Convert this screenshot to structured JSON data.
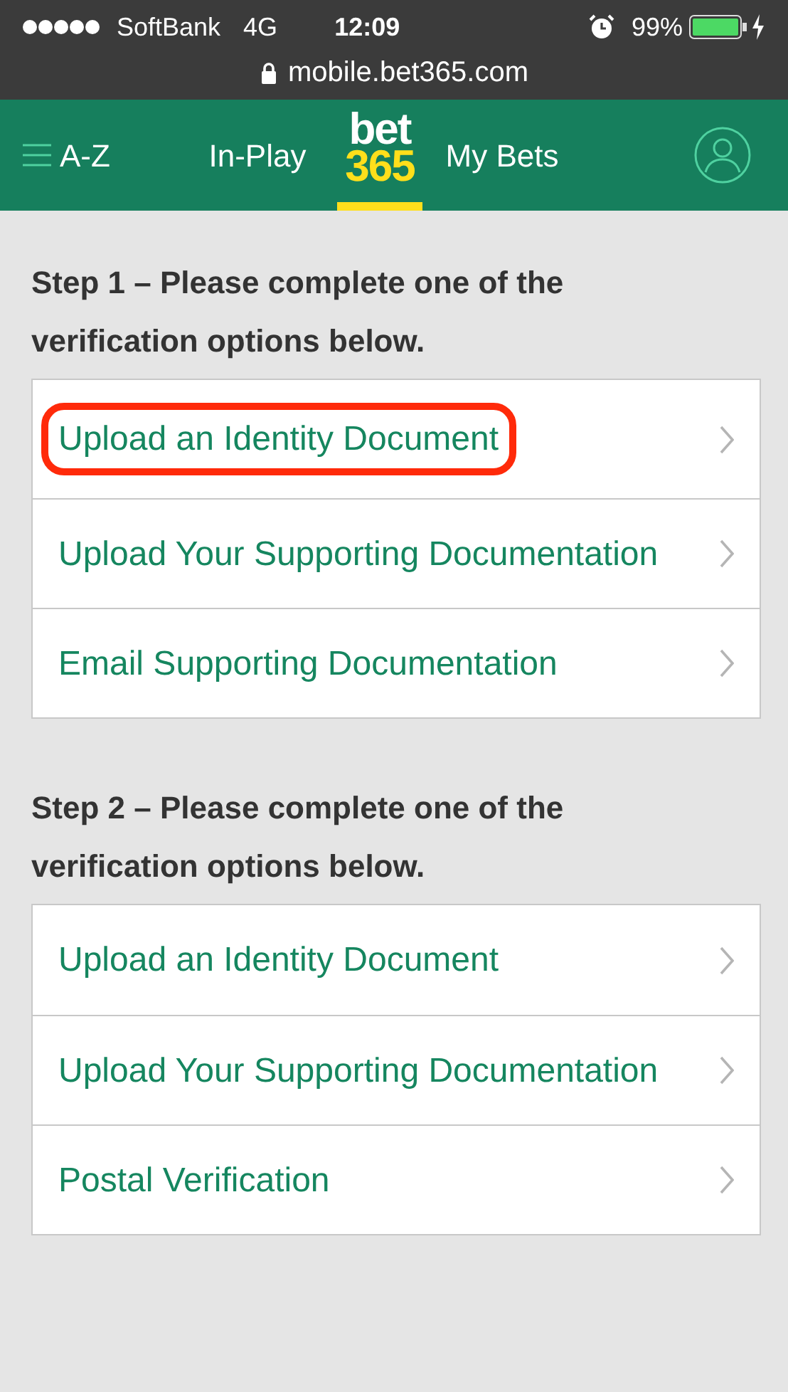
{
  "status_bar": {
    "carrier": "SoftBank",
    "network": "4G",
    "time": "12:09",
    "battery": "99%"
  },
  "address_bar": {
    "url": "mobile.bet365.com"
  },
  "nav": {
    "items": [
      {
        "kind": "menu",
        "label": "A-Z"
      },
      {
        "kind": "link",
        "label": "In-Play"
      },
      {
        "kind": "logo",
        "label": "bet",
        "label_2": "365"
      },
      {
        "kind": "link",
        "label": "My Bets"
      },
      {
        "kind": "account"
      }
    ]
  },
  "sections": [
    {
      "heading": "Step 1 – Please complete one of the verification options below.",
      "options": [
        {
          "label": "Upload an Identity Document",
          "highlighted": true
        },
        {
          "label": "Upload Your Supporting Documentation",
          "highlighted": false
        },
        {
          "label": "Email Supporting Documentation",
          "highlighted": false
        }
      ]
    },
    {
      "heading": "Step 2 – Please complete one of the verification options below.",
      "options": [
        {
          "label": "Upload an Identity Document",
          "highlighted": false
        },
        {
          "label": "Upload Your Supporting Documentation",
          "highlighted": false
        },
        {
          "label": "Postal Verification",
          "highlighted": false
        }
      ]
    }
  ]
}
